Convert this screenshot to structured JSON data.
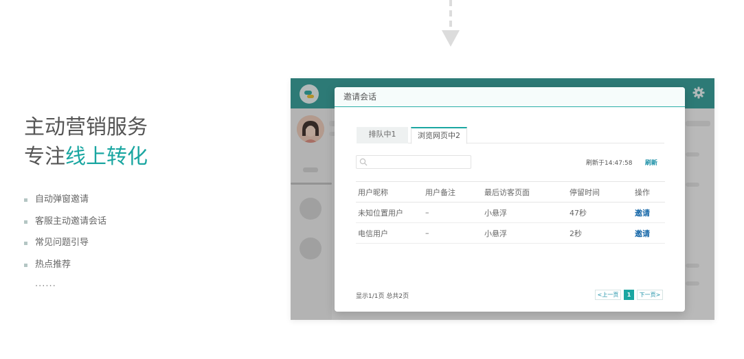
{
  "marketing": {
    "headline_line1": "主动营销服务",
    "headline_line2_prefix": "专注",
    "headline_line2_highlight": "线上转化",
    "features": [
      "自动弹窗邀请",
      "客服主动邀请会话",
      "常见问题引导",
      "热点推荐"
    ],
    "more": "......"
  },
  "dialog": {
    "title": "邀请会话",
    "tabs": [
      {
        "label": "排队中1",
        "active": false
      },
      {
        "label": "浏览网页中2",
        "active": true
      }
    ],
    "search": {
      "value": "",
      "placeholder": ""
    },
    "refresh_time": "刷新于14:47:58",
    "refresh_label": "刷新",
    "table": {
      "columns": [
        "用户昵称",
        "用户备注",
        "最后访客页面",
        "停留时间",
        "操作"
      ],
      "rows": [
        [
          "未知位置用户",
          "–",
          "小悬浮",
          "47秒",
          "邀请"
        ],
        [
          "电信用户",
          "–",
          "小悬浮",
          "2秒",
          "邀请"
        ]
      ]
    },
    "footer_info": "显示1/1页 总共2页",
    "pager": {
      "prev": "<上一页",
      "current": "1",
      "next": "下一页>"
    }
  },
  "colors": {
    "accent": "#1aa6a1",
    "header": "#309a95",
    "link": "#1667a8"
  },
  "icons": [
    "dashed-down-arrow-icon",
    "app-logo-icon",
    "gear-icon",
    "search-icon"
  ]
}
